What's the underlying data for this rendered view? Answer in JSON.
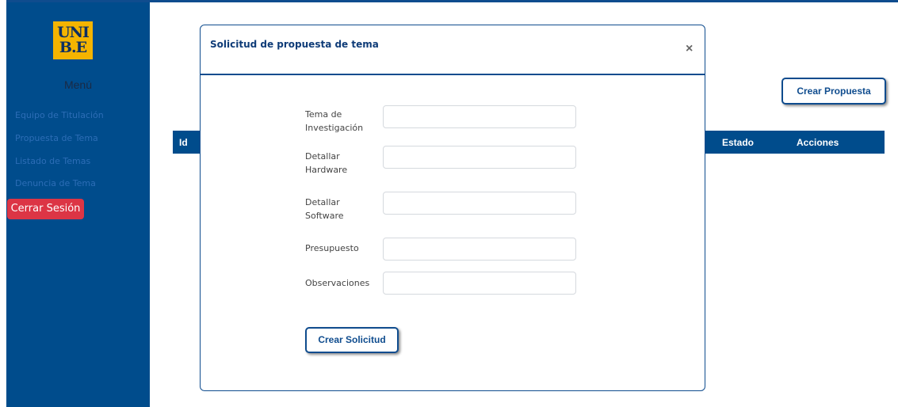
{
  "logo": {
    "text": "UNI B.E"
  },
  "sidebar": {
    "menu_title": "Menú",
    "items": [
      {
        "label": "Equipo de Titulación"
      },
      {
        "label": "Propuesta de Tema"
      },
      {
        "label": "Listado de Temas"
      },
      {
        "label": "Denuncia de Tema"
      }
    ],
    "logout_label": "Cerrar Sesión"
  },
  "main": {
    "create_button": "Crear Propuesta",
    "table": {
      "columns": [
        "Id",
        "Estado",
        "Acciones"
      ]
    }
  },
  "modal": {
    "title": "Solicitud de propuesta de tema",
    "close_glyph": "×",
    "fields": [
      {
        "label": "Tema de Investigación",
        "value": ""
      },
      {
        "label": "Detallar Hardware",
        "value": ""
      },
      {
        "label": "Detallar Software",
        "value": ""
      },
      {
        "label": "Presupuesto",
        "value": ""
      },
      {
        "label": "Observaciones",
        "value": ""
      }
    ],
    "submit_label": "Crear Solicitud"
  },
  "colors": {
    "primary": "#004c8c",
    "logo_bg": "#f4b400",
    "danger": "#dc3545"
  }
}
